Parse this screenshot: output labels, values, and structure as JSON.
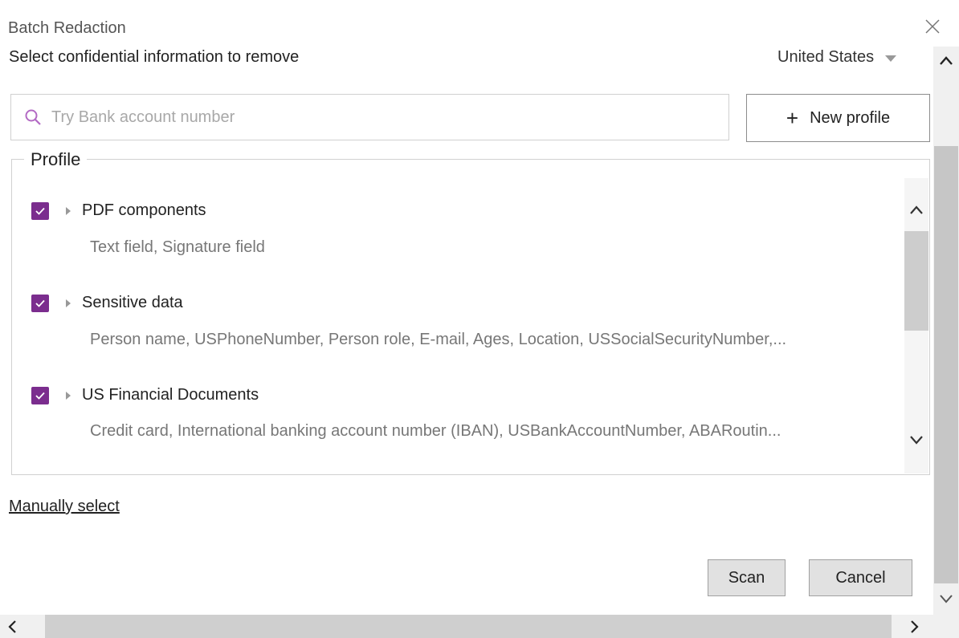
{
  "dialog": {
    "title": "Batch Redaction",
    "subtitle": "Select confidential information to remove",
    "country": "United States"
  },
  "search": {
    "placeholder": "Try Bank account number"
  },
  "new_profile": {
    "label": "New profile"
  },
  "profile": {
    "legend": "Profile",
    "items": [
      {
        "name": "PDF components",
        "checked": true,
        "detail": "Text field, Signature field"
      },
      {
        "name": "Sensitive data",
        "checked": true,
        "detail": "Person name, USPhoneNumber, Person role, E-mail, Ages, Location, USSocialSecurityNumber,..."
      },
      {
        "name": "US Financial Documents",
        "checked": true,
        "detail": "Credit card, International banking account number (IBAN), USBankAccountNumber, ABARoutin..."
      }
    ]
  },
  "manual_select": "Manually select",
  "buttons": {
    "scan": "Scan",
    "cancel": "Cancel"
  },
  "colors": {
    "checkbox": "#7b2d8e",
    "search_icon": "#b36ac4"
  }
}
